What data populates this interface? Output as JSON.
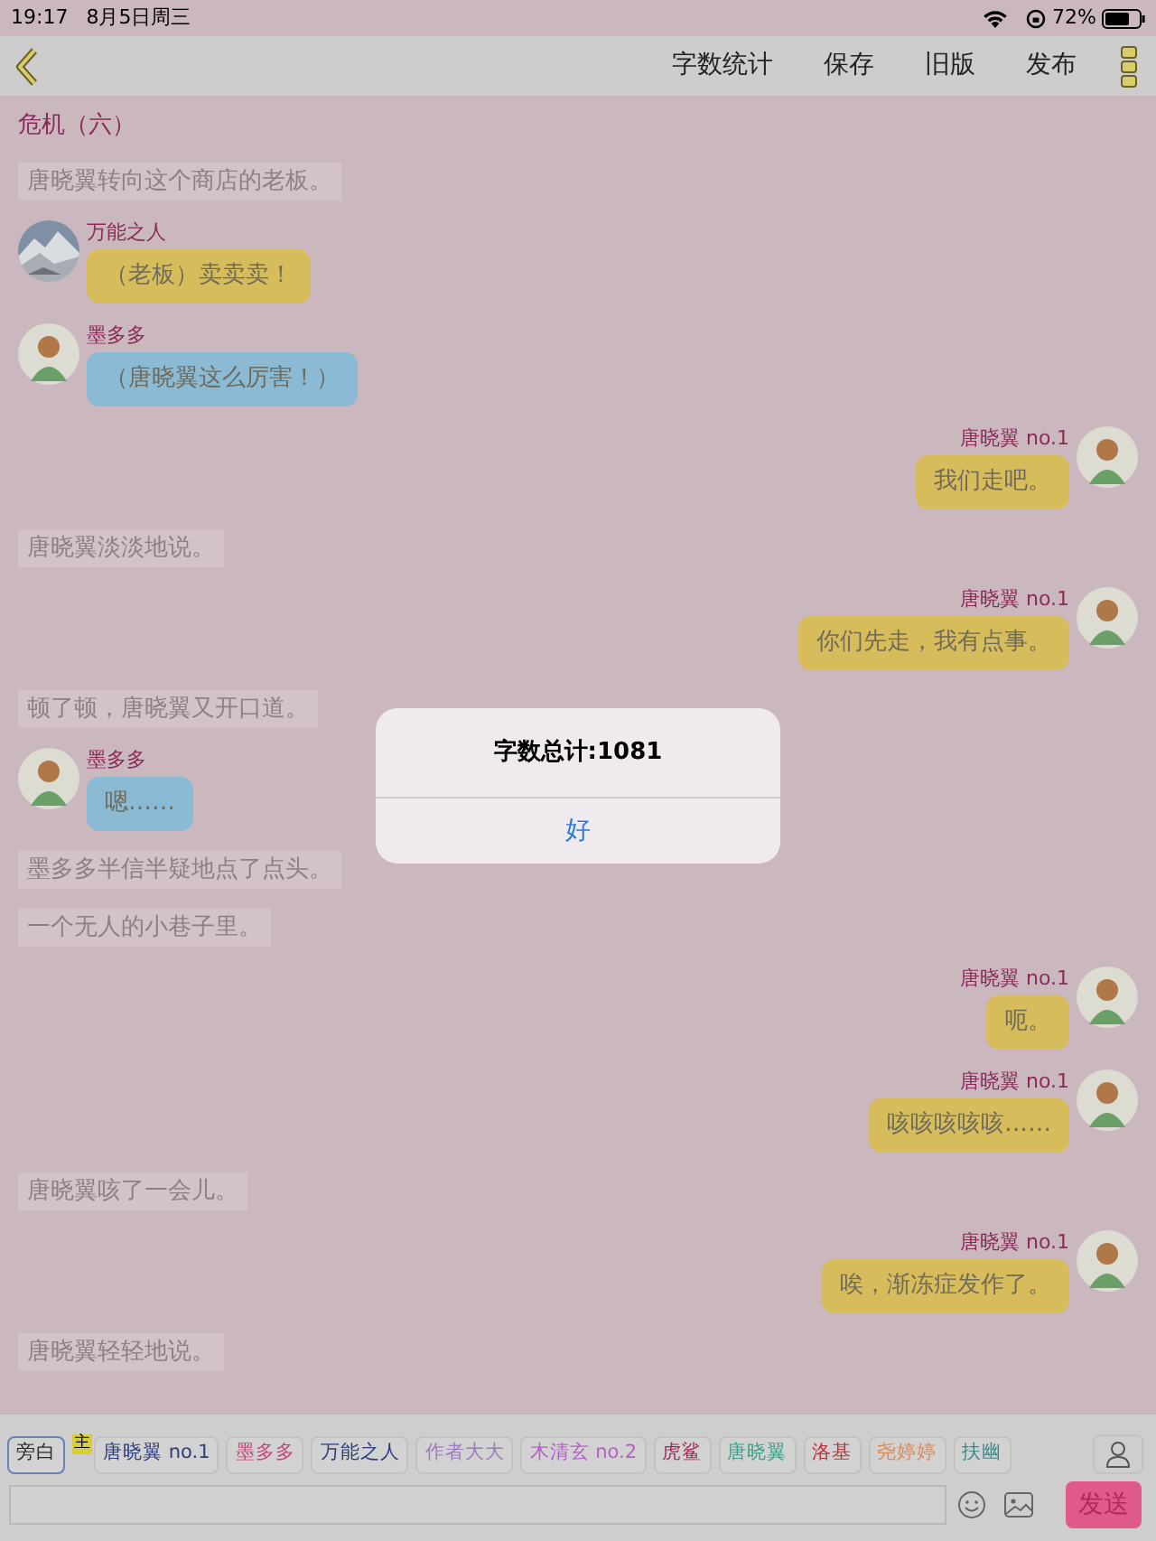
{
  "status_bar": {
    "time": "19:17",
    "date": "8月5日周三",
    "battery": "72%"
  },
  "toolbar": {
    "actions": [
      "字数统计",
      "保存",
      "旧版",
      "发布"
    ]
  },
  "chapter_title": "危机（六）",
  "messages": [
    {
      "kind": "narration",
      "text": "唐晓翼转向这个商店的老板。"
    },
    {
      "kind": "left",
      "name": "万能之人",
      "photo": true,
      "color": "#d7bc5c",
      "text": "（老板）卖卖卖！"
    },
    {
      "kind": "left",
      "name": "墨多多",
      "photo": false,
      "color": "#8bbad4",
      "text": "（唐晓翼这么厉害！）"
    },
    {
      "kind": "right",
      "name": "唐晓翼 no.1",
      "photo": false,
      "color": "#d7bc5c",
      "text": "我们走吧。"
    },
    {
      "kind": "narration",
      "text": "唐晓翼淡淡地说。"
    },
    {
      "kind": "right",
      "name": "唐晓翼 no.1",
      "photo": false,
      "color": "#d7bc5c",
      "text": "你们先走，我有点事。"
    },
    {
      "kind": "narration",
      "text": "顿了顿，唐晓翼又开口道。"
    },
    {
      "kind": "left",
      "name": "墨多多",
      "photo": false,
      "color": "#8bbad4",
      "text": "嗯……"
    },
    {
      "kind": "narration",
      "text": "墨多多半信半疑地点了点头。"
    },
    {
      "kind": "narration",
      "text": "一个无人的小巷子里。"
    },
    {
      "kind": "right",
      "name": "唐晓翼 no.1",
      "photo": false,
      "color": "#d7bc5c",
      "text": "呃。"
    },
    {
      "kind": "right",
      "name": "唐晓翼 no.1",
      "photo": false,
      "color": "#d7bc5c",
      "text": "咳咳咳咳咳……"
    },
    {
      "kind": "narration",
      "text": "唐晓翼咳了一会儿。"
    },
    {
      "kind": "right",
      "name": "唐晓翼 no.1",
      "photo": false,
      "color": "#d7bc5c",
      "text": "唉，渐冻症发作了。"
    },
    {
      "kind": "narration",
      "text": "唐晓翼轻轻地说。"
    }
  ],
  "characters": [
    {
      "label": "旁白",
      "color": "#2a2a2a",
      "selected": true
    },
    {
      "label": "唐晓翼 no.1",
      "color": "#2d3d7a",
      "selected": false,
      "badge": "主"
    },
    {
      "label": "墨多多",
      "color": "#c4427a",
      "selected": false
    },
    {
      "label": "万能之人",
      "color": "#2d3d7a",
      "selected": false
    },
    {
      "label": "作者大大",
      "color": "#a07ac0",
      "selected": false
    },
    {
      "label": "木清玄 no.2",
      "color": "#b460c8",
      "selected": false
    },
    {
      "label": "虎鲨",
      "color": "#a0285a",
      "selected": false
    },
    {
      "label": "唐晓翼",
      "color": "#3aa08a",
      "selected": false
    },
    {
      "label": "洛基",
      "color": "#c0343c",
      "selected": false
    },
    {
      "label": "尧婷婷",
      "color": "#d88a5a",
      "selected": false
    },
    {
      "label": "扶幽",
      "color": "#3a8a8a",
      "selected": false
    }
  ],
  "composer": {
    "send": "发送"
  },
  "dialog": {
    "title": "字数总计:1081",
    "button": "好"
  }
}
